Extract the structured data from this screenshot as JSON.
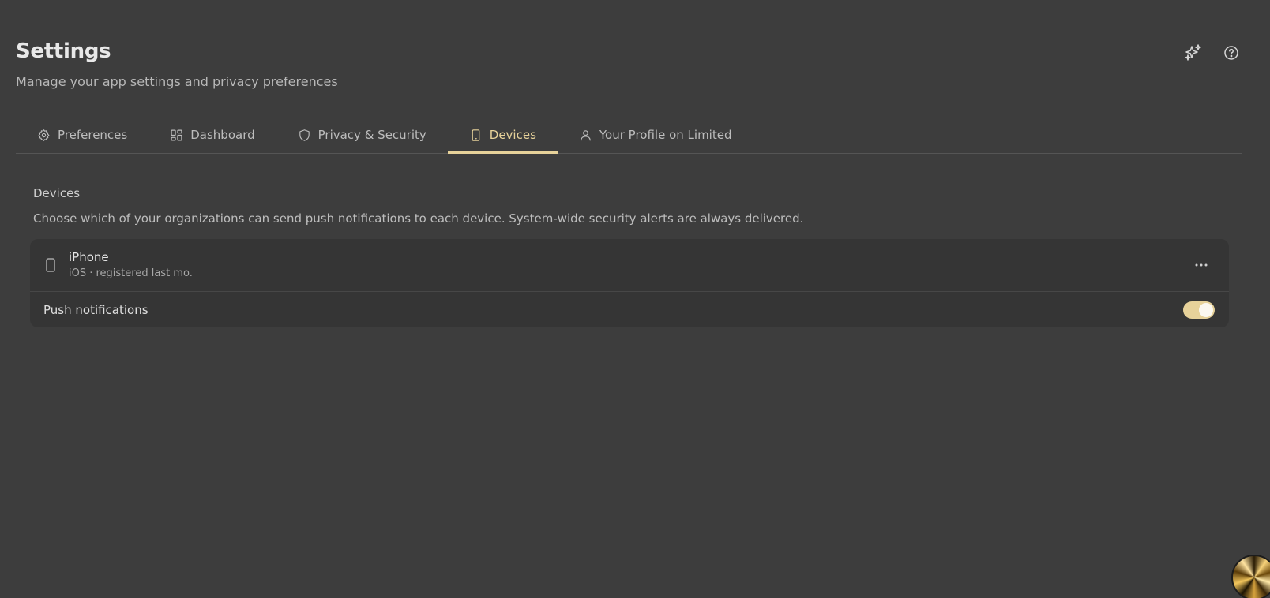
{
  "header": {
    "title": "Settings",
    "subtitle": "Manage your app settings and privacy preferences",
    "actions": [
      {
        "icon": "sparkles-icon"
      },
      {
        "icon": "help-circle-icon"
      }
    ]
  },
  "tabs": [
    {
      "label": "Preferences",
      "icon": "gear-icon",
      "active": false
    },
    {
      "label": "Dashboard",
      "icon": "grid-icon",
      "active": false
    },
    {
      "label": "Privacy & Security",
      "icon": "shield-icon",
      "active": false
    },
    {
      "label": "Devices",
      "icon": "phone-icon",
      "active": true
    },
    {
      "label": "Your Profile on Limited",
      "icon": "user-icon",
      "active": false
    }
  ],
  "devices_section": {
    "title": "Devices",
    "description": "Choose which of your organizations can send push notifications to each device. System-wide security alerts are always delivered.",
    "device": {
      "name": "iPhone",
      "meta": "iOS · registered last mo.",
      "icon": "phone-icon",
      "push_label": "Push notifications",
      "push_enabled": true
    }
  },
  "colors": {
    "background": "#3d3d3d",
    "card": "#353535",
    "accent": "#e7d29a",
    "text": "#e0e0e0",
    "muted": "#bdbdbd"
  }
}
